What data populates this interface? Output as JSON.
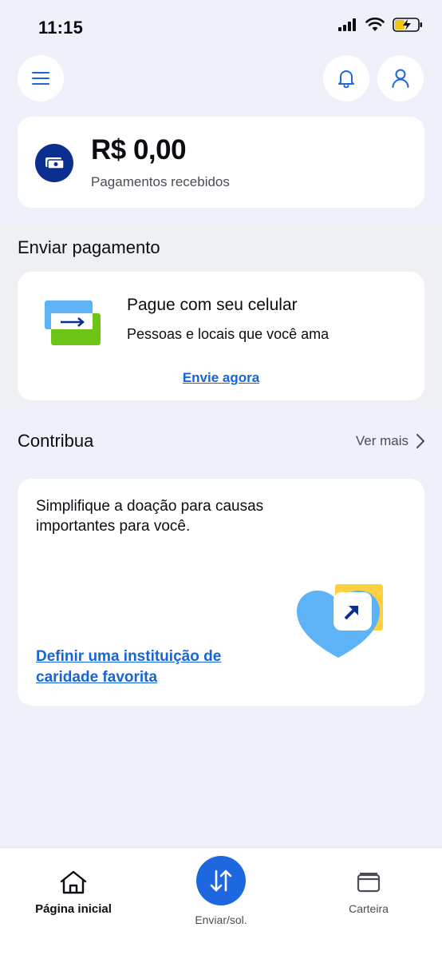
{
  "status_bar": {
    "time": "11:15"
  },
  "balance": {
    "amount": "R$ 0,00",
    "label": "Pagamentos recebidos"
  },
  "send": {
    "section_title": "Enviar pagamento",
    "headline": "Pague com seu celular",
    "subtitle": "Pessoas e locais que você ama",
    "link": "Envie agora"
  },
  "contribute": {
    "section_title": "Contribua",
    "see_more": "Ver mais",
    "text": "Simplifique a doação para causas importantes para você.",
    "link": "Definir uma instituição de caridade favorita"
  },
  "bottom_nav": {
    "home": "Página inicial",
    "send": "Enviar/sol.",
    "wallet": "Carteira"
  },
  "icons": {
    "menu": "hamburger-menu-icon",
    "bell": "bell-icon",
    "user": "user-icon",
    "balance": "money-icon",
    "home": "home-icon",
    "send": "transfer-arrows-icon",
    "wallet": "wallet-icon",
    "chevron": "chevron-right-icon"
  },
  "colors": {
    "accent_blue": "#1d67e0",
    "link_blue": "#1565d8",
    "dark_navy": "#0b2f8f",
    "background": "#eef1fa"
  }
}
